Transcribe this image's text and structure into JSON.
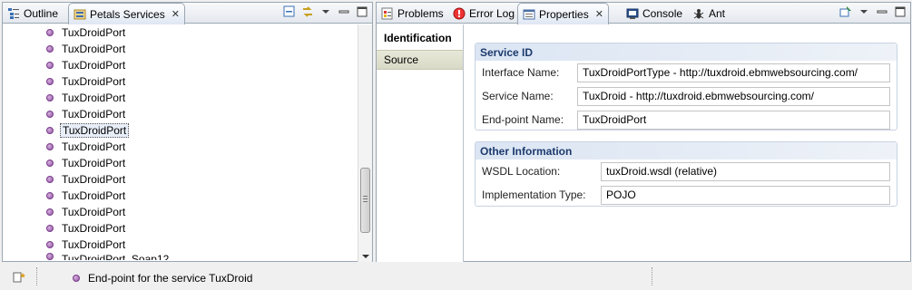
{
  "left_tabs": {
    "outline_label": "Outline",
    "petals_label": "Petals Services"
  },
  "tree": {
    "items": [
      "TuxDroidPort",
      "TuxDroidPort",
      "TuxDroidPort",
      "TuxDroidPort",
      "TuxDroidPort",
      "TuxDroidPort",
      "TuxDroidPort",
      "TuxDroidPort",
      "TuxDroidPort",
      "TuxDroidPort",
      "TuxDroidPort",
      "TuxDroidPort",
      "TuxDroidPort",
      "TuxDroidPort"
    ],
    "selected_index": 6,
    "partial_item": "TuxDroidPort_Soap12"
  },
  "right_tabs": {
    "problems": "Problems",
    "error_log": "Error Log",
    "properties": "Properties",
    "console": "Console",
    "ant": "Ant"
  },
  "side_tabs": {
    "identification": "Identification",
    "source": "Source"
  },
  "service_id": {
    "title": "Service ID",
    "interface_label": "Interface Name:",
    "interface_value": "TuxDroidPortType - http://tuxdroid.ebmwebsourcing.com/",
    "service_label": "Service Name:",
    "service_value": "TuxDroid - http://tuxdroid.ebmwebsourcing.com/",
    "endpoint_label": "End-point Name:",
    "endpoint_value": "TuxDroidPort"
  },
  "other_info": {
    "title": "Other Information",
    "wsdl_label": "WSDL Location:",
    "wsdl_value": "tuxDroid.wsdl (relative)",
    "impl_label": "Implementation Type:",
    "impl_value": "POJO"
  },
  "status": {
    "message": "End-point for the service TuxDroid"
  },
  "colors": {
    "node_purple": "#8e52a0",
    "section_title": "#1c3a6e"
  }
}
